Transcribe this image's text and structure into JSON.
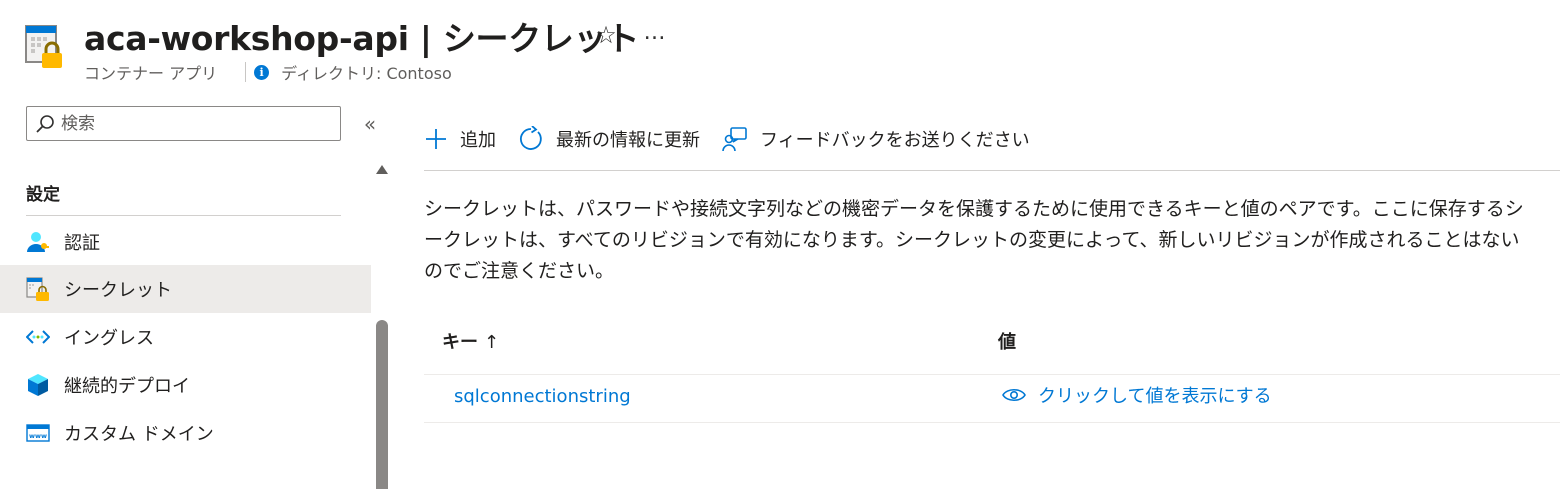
{
  "header": {
    "title": "aca-workshop-api | シークレット",
    "resource_type": "コンテナー アプリ",
    "directory": "ディレクトリ: Contoso",
    "favorite_icon": "star-icon",
    "more_icon": "ellipsis-icon",
    "more_label": "…",
    "star_label": "☆"
  },
  "sidebar": {
    "search_placeholder": "検索",
    "collapse_label": "«",
    "section": "設定",
    "items": [
      {
        "label": "認証",
        "icon": "user-key-icon",
        "selected": false
      },
      {
        "label": "シークレット",
        "icon": "secret-lock-icon",
        "selected": true
      },
      {
        "label": "イングレス",
        "icon": "ingress-icon",
        "selected": false
      },
      {
        "label": "継続的デプロイ",
        "icon": "cube-deploy-icon",
        "selected": false
      },
      {
        "label": "カスタム ドメイン",
        "icon": "www-icon",
        "selected": false
      }
    ]
  },
  "toolbar": {
    "add_label": "追加",
    "refresh_label": "最新の情報に更新",
    "feedback_label": "フィードバックをお送りください"
  },
  "description": "シークレットは、パスワードや接続文字列などの機密データを保護するために使用できるキーと値のペアです。ここに保存するシークレットは、すべてのリビジョンで有効になります。シークレットの変更によって、新しいリビジョンが作成されることはないのでご注意ください。",
  "table": {
    "columns": {
      "key": "キー",
      "key_sort_indicator": "↑",
      "value": "値"
    },
    "rows": [
      {
        "key": "sqlconnectionstring",
        "value_action": "クリックして値を表示にする"
      }
    ]
  },
  "colors": {
    "accent": "#0078d4",
    "selected_bg": "#edebe9",
    "text": "#201f1e"
  }
}
